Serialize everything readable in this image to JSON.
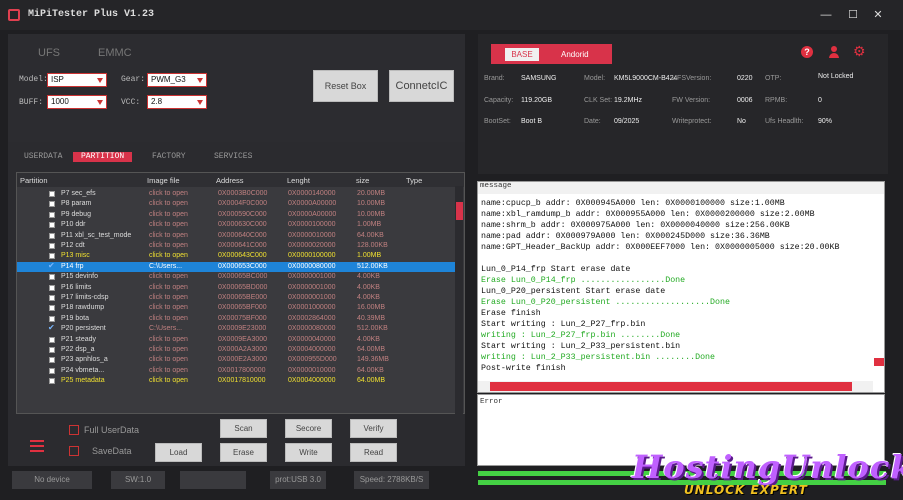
{
  "app": {
    "title": "MiPiTester Plus V1.23",
    "win_min": "—",
    "win_max": "☐",
    "win_close": "✕"
  },
  "left_tabs": [
    "UFS",
    "EMMC"
  ],
  "options": {
    "model_label": "Model:",
    "model_value": "ISP",
    "gear_label": "Gear:",
    "gear_value": "PWM_G3",
    "buff_label": "BUFF:",
    "buff_value": "1000",
    "vcc_label": "VCC:",
    "vcc_value": "2.8"
  },
  "buttons": {
    "reset_box": "Reset Box",
    "connect": "ConnetcIC",
    "scan": "Scan",
    "secore": "Secore",
    "verify": "Verify",
    "load": "Load",
    "erase": "Erase",
    "write": "Write",
    "read": "Read"
  },
  "sub_tabs": [
    "USERDATA",
    "PARTITION",
    "FACTORY",
    "SERVICES"
  ],
  "table": {
    "headers": [
      "Partition",
      "Image file",
      "Address",
      "Lenght",
      "size",
      "Type"
    ],
    "rows": [
      {
        "checked": false,
        "part": "P7 sec_efs",
        "file": "click to open",
        "addr": "0X0003B0C000",
        "len": "0X0000140000",
        "size": "20.00MB",
        "style": "n"
      },
      {
        "checked": false,
        "part": "P8 param",
        "file": "click to open",
        "addr": "0X0004F0C000",
        "len": "0X0000A00000",
        "size": "10.00MB",
        "style": "n"
      },
      {
        "checked": false,
        "part": "P9 debug",
        "file": "click to open",
        "addr": "0X000590C000",
        "len": "0X0000A00000",
        "size": "10.00MB",
        "style": "n"
      },
      {
        "checked": false,
        "part": "P10 ddr",
        "file": "click to open",
        "addr": "0X000630C000",
        "len": "0X0000100000",
        "size": "1.00MB",
        "style": "n"
      },
      {
        "checked": false,
        "part": "P11 xbl_sc_test_mode",
        "file": "click to open",
        "addr": "0X000640C000",
        "len": "0X0000010000",
        "size": "64.00KB",
        "style": "n"
      },
      {
        "checked": false,
        "part": "P12 cdt",
        "file": "click to open",
        "addr": "0X000641C000",
        "len": "0X0000020000",
        "size": "128.00KB",
        "style": "n"
      },
      {
        "checked": false,
        "part": "P13 misc",
        "file": "click to open",
        "addr": "0X000643C000",
        "len": "0X0000100000",
        "size": "1.00MB",
        "style": "hl"
      },
      {
        "checked": true,
        "part": "P14 frp",
        "file": "C:\\Users...",
        "addr": "0X000653C000",
        "len": "0X0000080000",
        "size": "512.00KB",
        "style": "sel"
      },
      {
        "checked": false,
        "part": "P15 devinfo",
        "file": "click to open",
        "addr": "0X00065BC000",
        "len": "0X0000001000",
        "size": "4.00KB",
        "style": "n"
      },
      {
        "checked": false,
        "part": "P16 limits",
        "file": "click to open",
        "addr": "0X00065BD000",
        "len": "0X0000001000",
        "size": "4.00KB",
        "style": "n"
      },
      {
        "checked": false,
        "part": "P17 limits-cdsp",
        "file": "click to open",
        "addr": "0X00065BE000",
        "len": "0X0000001000",
        "size": "4.00KB",
        "style": "n"
      },
      {
        "checked": false,
        "part": "P18 rawdump",
        "file": "click to open",
        "addr": "0X00065BF000",
        "len": "0X0001000000",
        "size": "16.00MB",
        "style": "n"
      },
      {
        "checked": false,
        "part": "P19 bota",
        "file": "click to open",
        "addr": "0X00075BF000",
        "len": "0X0002864000",
        "size": "40.39MB",
        "style": "n"
      },
      {
        "checked": true,
        "part": "P20 persistent",
        "file": "C:\\Users...",
        "addr": "0X0009E23000",
        "len": "0X0000080000",
        "size": "512.00KB",
        "style": "n"
      },
      {
        "checked": false,
        "part": "P21 steady",
        "file": "click to open",
        "addr": "0X0009EA3000",
        "len": "0X0000040000",
        "size": "4.00KB",
        "style": "n"
      },
      {
        "checked": false,
        "part": "P22 dsp_a",
        "file": "click to open",
        "addr": "0X000A2A3000",
        "len": "0X0004000000",
        "size": "64.00MB",
        "style": "n"
      },
      {
        "checked": false,
        "part": "P23 apnhlos_a",
        "file": "click to open",
        "addr": "0X000E2A3000",
        "len": "0X000955D000",
        "size": "149.36MB",
        "style": "n"
      },
      {
        "checked": false,
        "part": "P24 vbmeta...",
        "file": "click to open",
        "addr": "0X0017800000",
        "len": "0X0000010000",
        "size": "64.00KB",
        "style": "n"
      },
      {
        "checked": false,
        "part": "P25 metadata",
        "file": "click to open",
        "addr": "0X0017810000",
        "len": "0X0004000000",
        "size": "64.00MB",
        "style": "hl"
      }
    ]
  },
  "checks": {
    "full_userdata": "Full UserData",
    "save_data": "SaveData"
  },
  "status": [
    "No device",
    "SW:1.0",
    "",
    "prot:USB 3.0",
    "Speed: 2788KB/S"
  ],
  "info_tabs": [
    "BASE",
    "Andorid"
  ],
  "info": [
    {
      "l": "Brand:",
      "v": "SAMSUNG"
    },
    {
      "l": "Model:",
      "v": "KM5L9000CM-B424"
    },
    {
      "l": "UFSVersion:",
      "v": "0220"
    },
    {
      "l": "OTP:",
      "v": "Not Locked"
    },
    {
      "l": "Capacity:",
      "v": "119.20GB"
    },
    {
      "l": "CLK Set:",
      "v": "19.2MHz"
    },
    {
      "l": "FW Version:",
      "v": "0006"
    },
    {
      "l": "RPMB:",
      "v": "0"
    },
    {
      "l": "BootSet:",
      "v": "Boot B"
    },
    {
      "l": "Date:",
      "v": "09/2025"
    },
    {
      "l": "Writeprotect:",
      "v": "No"
    },
    {
      "l": "Ufs Headlth:",
      "v": "90%"
    }
  ],
  "message": {
    "title": "message",
    "lines": [
      {
        "t": "name:cpucp_b addr: 0X000945A000  len: 0X0000100000  size:1.00MB",
        "g": false
      },
      {
        "t": "name:xbl_ramdump_b addr: 0X000955A000  len: 0X0000200000  size:2.00MB",
        "g": false
      },
      {
        "t": "name:shrm_b addr: 0X000975A000  len: 0X0000040000  size:256.00KB",
        "g": false
      },
      {
        "t": "name:pad addr: 0X000979A000  len: 0X000245D000  size:36.36MB",
        "g": false
      },
      {
        "t": "name:GPT_Header_BackUp addr: 0X000EEF7000  len: 0X0000005000  size:20.00KB",
        "g": false
      },
      {
        "t": "",
        "g": false
      },
      {
        "t": "Lun_0_P14_frp Start erase date",
        "g": false
      },
      {
        "t": "Erase  Lun_0_P14_frp  .................Done",
        "g": true
      },
      {
        "t": "Lun_0_P20_persistent Start erase date",
        "g": false
      },
      {
        "t": "Erase  Lun_0_P20_persistent  ...................Done",
        "g": true
      },
      {
        "t": "Erase finish",
        "g": false
      },
      {
        "t": "Start writing : Lun_2_P27_frp.bin",
        "g": false
      },
      {
        "t": "writing : Lun_2_P27_frp.bin  ........Done",
        "g": true
      },
      {
        "t": "Start writing : Lun_2_P33_persistent.bin",
        "g": false
      },
      {
        "t": "writing : Lun_2_P33_persistent.bin  ........Done",
        "g": true
      },
      {
        "t": "Post-write finish",
        "g": false
      }
    ]
  },
  "error": {
    "title": "Error"
  },
  "watermark": "HostingUnlock",
  "watermark_sub": "UNLOCK EXPERT"
}
